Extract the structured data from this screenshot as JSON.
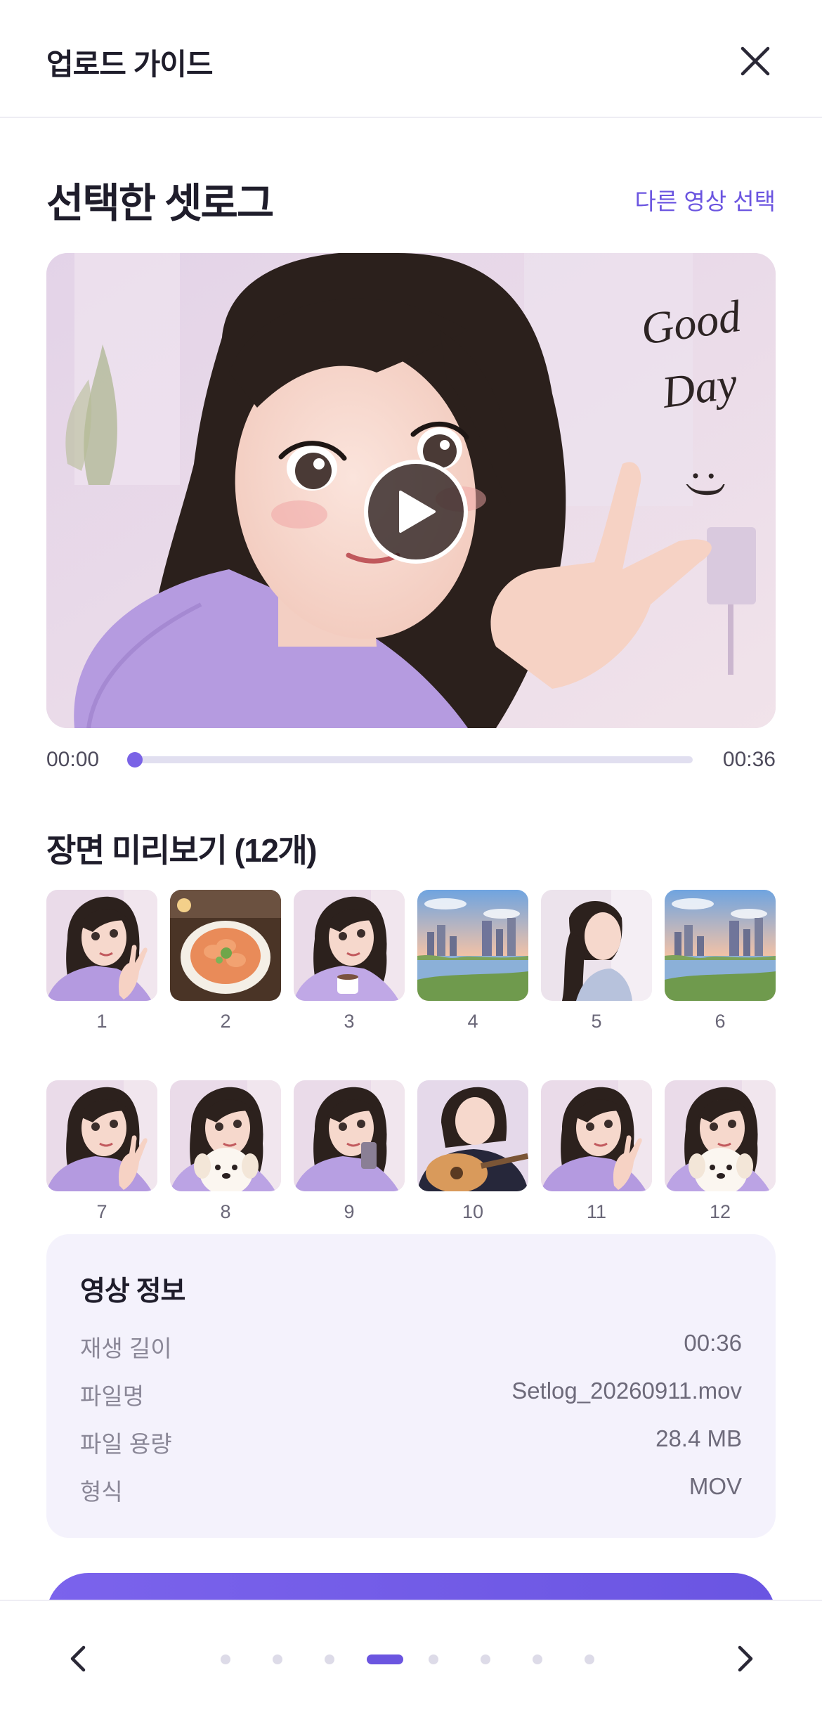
{
  "header": {
    "title": "업로드 가이드"
  },
  "selected": {
    "title": "선택한 셋로그",
    "alt_link": "다른 영상 선택"
  },
  "video": {
    "overlay_text_line1": "Good",
    "overlay_text_line2": "Day",
    "overlay_text_line3": ":)",
    "time_current": "00:00",
    "time_total": "00:36",
    "progress_fraction": 0.01
  },
  "scenes": {
    "title": "장면 미리보기 (12개)",
    "items": [
      {
        "num": "1",
        "kind": "girl-peace-icon"
      },
      {
        "num": "2",
        "kind": "food-plate-icon"
      },
      {
        "num": "3",
        "kind": "girl-coffee-icon"
      },
      {
        "num": "4",
        "kind": "city-river-icon"
      },
      {
        "num": "5",
        "kind": "girl-profile-icon"
      },
      {
        "num": "6",
        "kind": "city-river-icon"
      },
      {
        "num": "7",
        "kind": "girl-peace-icon"
      },
      {
        "num": "8",
        "kind": "girl-puppy-icon"
      },
      {
        "num": "9",
        "kind": "girl-phone-icon"
      },
      {
        "num": "10",
        "kind": "girl-guitar-icon"
      },
      {
        "num": "11",
        "kind": "girl-peace-icon"
      },
      {
        "num": "12",
        "kind": "girl-puppy-icon"
      }
    ]
  },
  "info": {
    "title": "영상 정보",
    "rows": [
      {
        "label": "재생 길이",
        "value": "00:36"
      },
      {
        "label": "파일명",
        "value": "Setlog_20260911.mov"
      },
      {
        "label": "파일 용량",
        "value": "28.4 MB"
      },
      {
        "label": "형식",
        "value": "MOV"
      }
    ]
  },
  "pagination": {
    "total": 8,
    "active_index": 3
  },
  "colors": {
    "accent": "#6b55e0",
    "card_bg": "#f4f2fc"
  }
}
